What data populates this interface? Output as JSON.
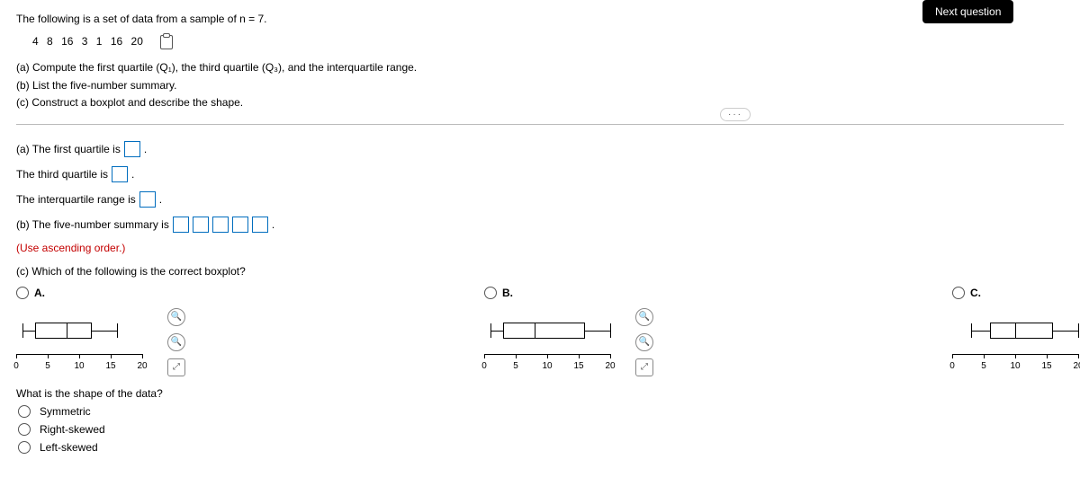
{
  "nav": {
    "next_button": "Next question"
  },
  "problem": {
    "intro": "The following is a set of data from a sample of n = 7.",
    "data": [
      "4",
      "8",
      "16",
      "3",
      "1",
      "16",
      "20"
    ],
    "part_a": "(a) Compute the first quartile (Q₁), the third quartile (Q₃), and the interquartile range.",
    "part_b": "(b) List the five-number summary.",
    "part_c": "(c) Construct a boxplot and describe the shape."
  },
  "answers": {
    "a_q1_label": "(a) The first quartile is",
    "a_q3_label": "The third quartile is",
    "a_iqr_label": "The interquartile range is",
    "b_label": "(b) The five-number summary is",
    "b_hint": "(Use ascending order.)",
    "c_label": "(c) Which of the following is the correct boxplot?",
    "period": "."
  },
  "options": {
    "A": "A.",
    "B": "B.",
    "C": "C."
  },
  "axis_ticks": [
    "0",
    "5",
    "10",
    "15",
    "20"
  ],
  "shape": {
    "question": "What is the shape of the data?",
    "opt1": "Symmetric",
    "opt2": "Right-skewed",
    "opt3": "Left-skewed"
  },
  "chart_data": [
    {
      "type": "boxplot",
      "option": "A",
      "axis_range": [
        0,
        20
      ],
      "min": 1,
      "q1": 3,
      "median": 8,
      "q3": 12,
      "max": 16
    },
    {
      "type": "boxplot",
      "option": "B",
      "axis_range": [
        0,
        20
      ],
      "min": 1,
      "q1": 3,
      "median": 8,
      "q3": 16,
      "max": 20
    },
    {
      "type": "boxplot",
      "option": "C",
      "axis_range": [
        0,
        20
      ],
      "min": 3,
      "q1": 6,
      "median": 10,
      "q3": 16,
      "max": 20
    }
  ]
}
